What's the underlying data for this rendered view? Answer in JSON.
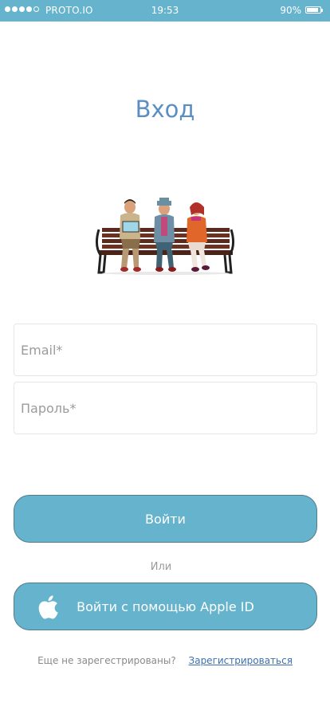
{
  "status_bar": {
    "carrier": "PROTO.IO",
    "time": "19:53",
    "battery": "90%",
    "battery_level": 0.9,
    "signal_bars": 4
  },
  "page": {
    "title": "Вход"
  },
  "form": {
    "email_placeholder": "Email*",
    "password_placeholder": "Пароль*"
  },
  "actions": {
    "login_label": "Войти",
    "or_text": "Или",
    "apple_label": "Войти с помощью Apple ID"
  },
  "footer": {
    "question": "Еще не зарегестрированы?",
    "register_link": "Зарегистрироваться"
  },
  "colors": {
    "accent": "#65b3cc",
    "title": "#5b8fc4",
    "link": "#3c6fb0"
  }
}
